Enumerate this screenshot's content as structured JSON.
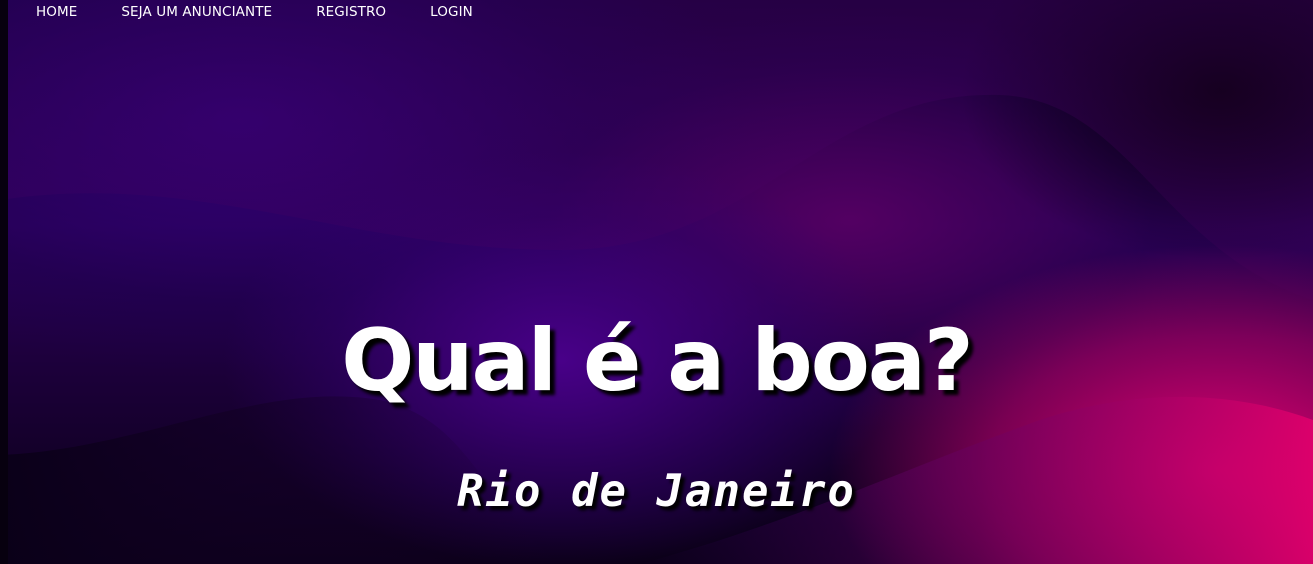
{
  "nav": {
    "items": [
      {
        "label": "HOME"
      },
      {
        "label": "SEJA UM ANUNCIANTE"
      },
      {
        "label": "REGISTRO"
      },
      {
        "label": "LOGIN"
      }
    ]
  },
  "hero": {
    "title": "Qual é a boa?",
    "subtitle": "Rio de Janeiro"
  },
  "colors": {
    "background_dark": "#120018",
    "purple": "#3a0080",
    "magenta": "#e8006e",
    "text": "#ffffff"
  }
}
